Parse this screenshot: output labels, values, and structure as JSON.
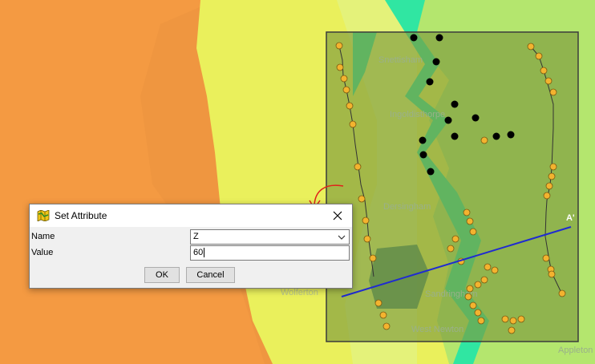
{
  "map": {
    "labels": [
      "Snettisham",
      "Ingoldisthorpe",
      "Dersingham",
      "Wolferton",
      "Sandringham",
      "West Newton",
      "Appleton"
    ],
    "section_label": "A'",
    "colors": {
      "land_orange": "#ef9640",
      "plain_yellow": "#eef05a",
      "coast_yellow": "#e2f272",
      "green": "#a9e06a",
      "teal": "#2ee6a0",
      "selection_fill": "#7d9a3e",
      "black_point": "#000000",
      "orange_point": "#f3b32f",
      "profile_line": "#1f2bd1",
      "annotation_arrow": "#e0231a"
    }
  },
  "dialog": {
    "title": "Set Attribute",
    "icon": "map-layer-icon",
    "close_icon": "close-icon",
    "name_label": "Name",
    "name_value": "Z",
    "value_label": "Value",
    "value_value": "60",
    "ok_label": "OK",
    "cancel_label": "Cancel"
  }
}
